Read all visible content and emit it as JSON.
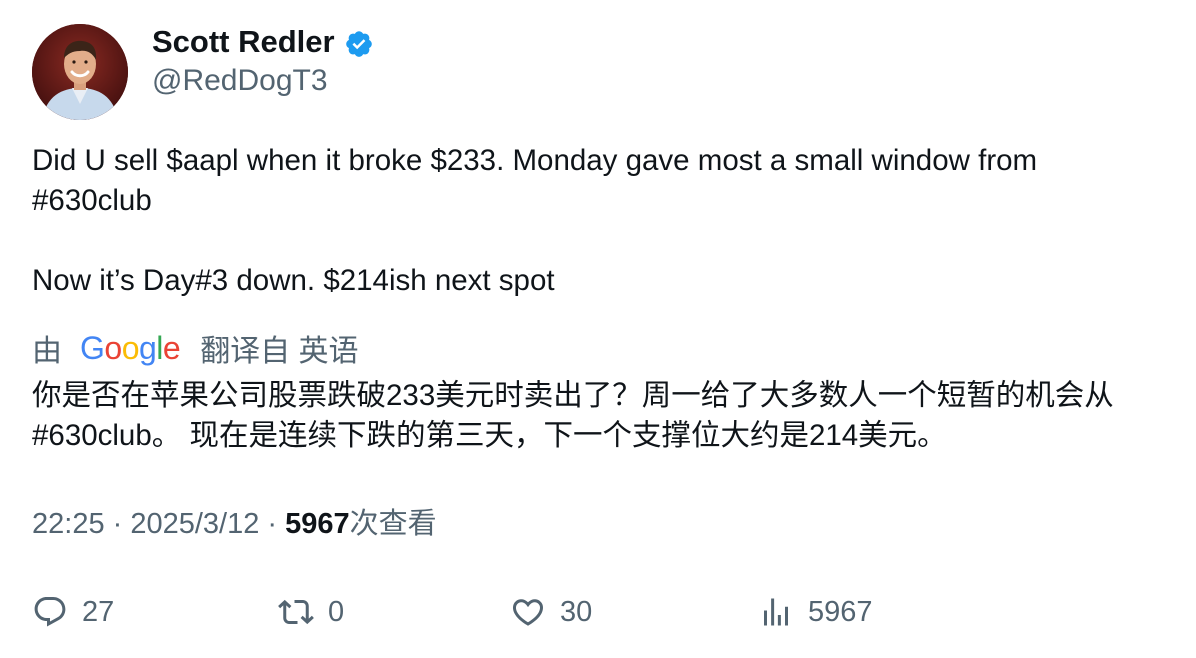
{
  "user": {
    "display_name": "Scott Redler",
    "handle": "@RedDogT3"
  },
  "tweet": {
    "line1": "Did U sell $aapl when it broke $233. Monday gave most a small window from #630club",
    "line2": "Now it’s Day#3 down. $214ish next spot"
  },
  "translation": {
    "prefix": "由",
    "provider_letters": [
      "G",
      "o",
      "o",
      "g",
      "l",
      "e"
    ],
    "suffix": "翻译自 英语",
    "text": "你是否在苹果公司股票跌破233美元时卖出了？周一给了大多数人一个短暂的机会从#630club。 现在是连续下跌的第三天，下一个支撑位大约是214美元。"
  },
  "meta": {
    "time": "22:25",
    "sep1": " · ",
    "date": "2025/3/12",
    "sep2": " · ",
    "views": "5967",
    "views_label": "次查看"
  },
  "actions": {
    "replies": "27",
    "retweets": "0",
    "likes": "30",
    "views": "5967"
  },
  "colors": {
    "text": "#0f1419",
    "secondary": "#536471",
    "verified": "#1d9bf0",
    "google_blue": "#4285F4",
    "google_red": "#EA4335",
    "google_yellow": "#FBBC05",
    "google_green": "#34A853"
  }
}
